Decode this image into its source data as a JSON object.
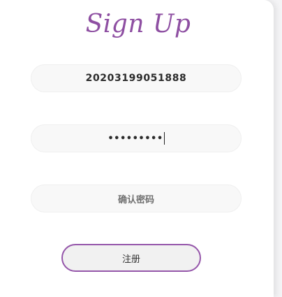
{
  "title": "Sign Up",
  "fields": {
    "username_value": "20203199051888",
    "password_value": "•••••••••",
    "confirm_placeholder": "确认密码"
  },
  "submit_label": "注册",
  "colors": {
    "accent": "#8e4fa2",
    "button_border": "#9556aa"
  }
}
